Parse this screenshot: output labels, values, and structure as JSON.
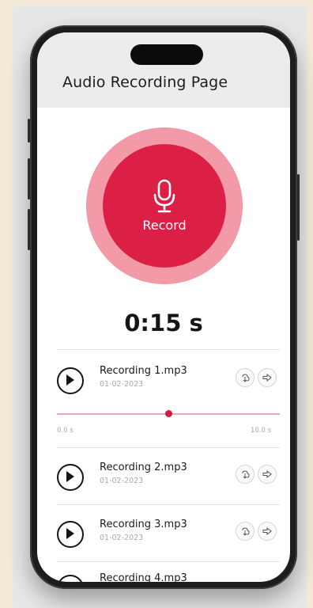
{
  "header": {
    "title": "Audio Recording Page"
  },
  "record": {
    "label": "Record",
    "icon": "microphone-icon"
  },
  "timer": {
    "value": "0:15 s"
  },
  "player": {
    "progress_fraction": 0.5,
    "start_label": "0.0 s",
    "end_label": "10.0 s"
  },
  "recordings": [
    {
      "name": "Recording 1.mp3",
      "date": "01-02-2023"
    },
    {
      "name": "Recording 2.mp3",
      "date": "01-02-2023"
    },
    {
      "name": "Recording 3.mp3",
      "date": "01-02-2023"
    },
    {
      "name": "Recording 4.mp3",
      "date": ""
    }
  ],
  "colors": {
    "accent": "#dc1f45",
    "accent_ring": "#f39aa9",
    "header_bg": "#ececec"
  }
}
